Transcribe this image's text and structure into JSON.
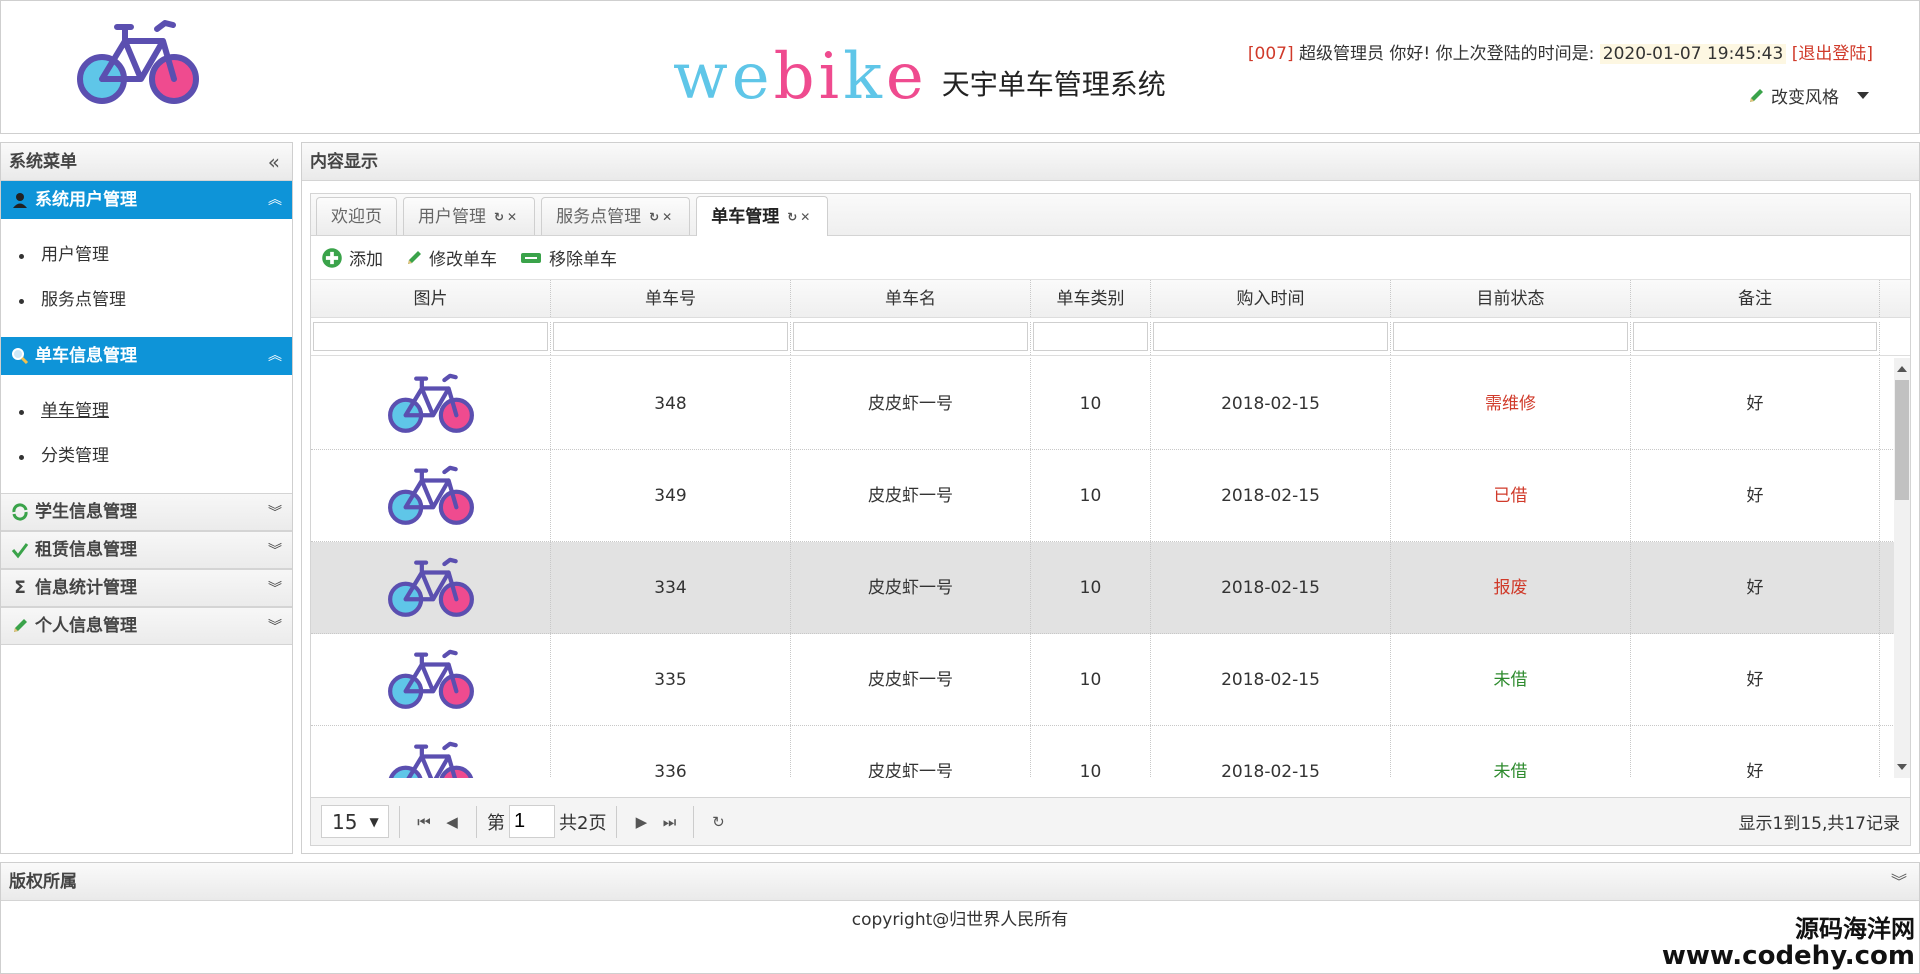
{
  "header": {
    "brand_part1": "we",
    "brand_part2": "bi",
    "brand_part3": "k",
    "brand_part4": "e",
    "brand_sub": "天宇单车管理系统",
    "user_id": "[007]",
    "greeting": " 超级管理员 你好! 你上次登陆的时间是: ",
    "last_login": "2020-01-07 19:45:43",
    "logout": "[退出登陆]",
    "style_switch": "改变风格"
  },
  "sidebar": {
    "title": "系统菜单",
    "groups": [
      {
        "label": "系统用户管理",
        "icon": "user-icon",
        "items": [
          "用户管理",
          "服务点管理"
        ]
      },
      {
        "label": "单车信息管理",
        "icon": "search-icon",
        "items": [
          "单车管理",
          "分类管理"
        ]
      },
      {
        "label": "学生信息管理",
        "icon": "refresh-icon"
      },
      {
        "label": "租赁信息管理",
        "icon": "check-icon"
      },
      {
        "label": "信息统计管理",
        "icon": "sigma-icon"
      },
      {
        "label": "个人信息管理",
        "icon": "pencil-icon"
      }
    ]
  },
  "content": {
    "title": "内容显示",
    "tabs": [
      "欢迎页",
      "用户管理",
      "服务点管理",
      "单车管理"
    ],
    "toolbar": {
      "add": "添加",
      "edit": "修改单车",
      "remove": "移除单车"
    },
    "columns": [
      "图片",
      "单车号",
      "单车名",
      "单车类别",
      "购入时间",
      "目前状态",
      "备注"
    ],
    "rows": [
      {
        "no": "348",
        "name": "皮皮虾一号",
        "category": "10",
        "date": "2018-02-15",
        "status": "需维修",
        "note": "好"
      },
      {
        "no": "349",
        "name": "皮皮虾一号",
        "category": "10",
        "date": "2018-02-15",
        "status": "已借",
        "note": "好"
      },
      {
        "no": "334",
        "name": "皮皮虾一号",
        "category": "10",
        "date": "2018-02-15",
        "status": "报废",
        "note": "好"
      },
      {
        "no": "335",
        "name": "皮皮虾一号",
        "category": "10",
        "date": "2018-02-15",
        "status": "未借",
        "note": "好"
      },
      {
        "no": "336",
        "name": "皮皮虾一号",
        "category": "10",
        "date": "2018-02-15",
        "status": "未借",
        "note": "好"
      }
    ],
    "pager": {
      "page_size": "15",
      "page_prefix": "第",
      "page": "1",
      "total_pages": "共2页",
      "info": "显示1到15,共17记录"
    }
  },
  "footer": {
    "title": "版权所属",
    "copyright": "copyright@归世界人民所有",
    "watermark1": "源码海洋网",
    "watermark2": "www.codehy.com"
  },
  "colors": {
    "accent": "#0e94d8",
    "danger": "#d03a2a",
    "ok": "#2e8b2e",
    "bike_frame": "#5b4fb0",
    "bike_front": "#5fc6e8",
    "bike_rear": "#ef4b8f"
  }
}
